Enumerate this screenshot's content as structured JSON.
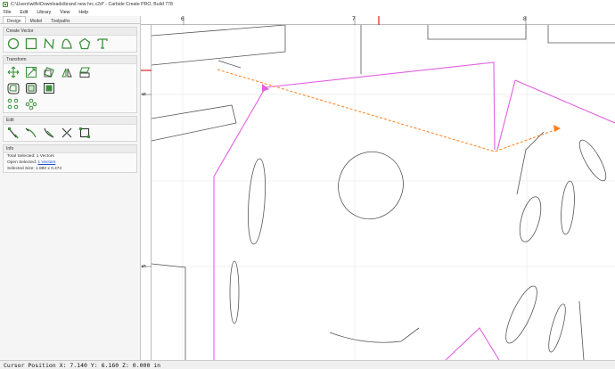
{
  "window": {
    "title": "C:\\Users\\wilfx\\Downloads\\brand new hrc.c2d* - Carbide Create PRO, Build 778"
  },
  "menu": [
    "File",
    "Edit",
    "Library",
    "View",
    "Help"
  ],
  "tabs": [
    "Design",
    "Model",
    "Toolpaths"
  ],
  "sections": {
    "create_vector": "Create Vector",
    "transform": "Transform",
    "edit": "Edit",
    "info": "Info"
  },
  "info": {
    "total_selected": "Total Selected: 1 Vectors",
    "open_selected_label": "Open Selected:",
    "open_selected_value": "1 Vectors",
    "selected_size": "Selected Size:   1.980 x 0.474"
  },
  "ruler": {
    "top_labels": [
      "6",
      "7",
      "8"
    ],
    "left_labels": [
      "6",
      "5"
    ]
  },
  "status": {
    "cursor": "Cursor Position X: 7.140 Y: 6.160 Z: 0.000 in"
  },
  "colors": {
    "accent_green": "#3a8f3a",
    "selection_magenta": "#e060e0",
    "preview_orange": "#ff7f1a",
    "cursor_marker": "#e02020"
  },
  "icons": {
    "create_vector": [
      "circle-icon",
      "rectangle-icon",
      "polyline-icon",
      "curve-icon",
      "polygon-icon",
      "text-icon"
    ],
    "transform_row1": [
      "move-icon",
      "scale-icon",
      "rotate-icon",
      "mirror-icon",
      "skew-icon"
    ],
    "transform_row2": [
      "offset-icon",
      "join-icon",
      "group-icon"
    ],
    "transform_row3": [
      "align-icon",
      "distribute-icon"
    ],
    "edit": [
      "node-edit-icon",
      "trim-icon",
      "fillet-icon",
      "cut-icon",
      "boundary-icon"
    ]
  }
}
